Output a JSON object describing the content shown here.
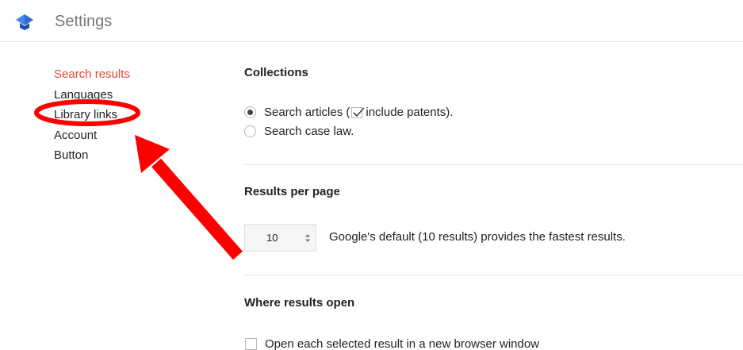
{
  "header": {
    "title": "Settings",
    "logo_icon": "scholar-cap-icon",
    "logo_color": "#4285f4"
  },
  "sidebar": {
    "items": [
      {
        "label": "Search results",
        "active": true
      },
      {
        "label": "Languages",
        "active": false
      },
      {
        "label": "Library links",
        "active": false
      },
      {
        "label": "Account",
        "active": false
      },
      {
        "label": "Button",
        "active": false
      }
    ],
    "active_color": "#dd4b39"
  },
  "collections": {
    "title": "Collections",
    "search_articles_label_prefix": "Search articles (",
    "include_patents_label": "include patents).",
    "search_case_law_label": "Search case law.",
    "selected": "search-articles",
    "include_patents_checked": true
  },
  "results_per_page": {
    "title": "Results per page",
    "value": "10",
    "note": "Google's default (10 results) provides the fastest results."
  },
  "where_results_open": {
    "title": "Where results open",
    "new_window_label": "Open each selected result in a new browser window",
    "new_window_checked": false
  },
  "annotation": {
    "color": "#ff0000",
    "shapes": [
      "ellipse",
      "arrow"
    ],
    "highlights": "Library links"
  }
}
